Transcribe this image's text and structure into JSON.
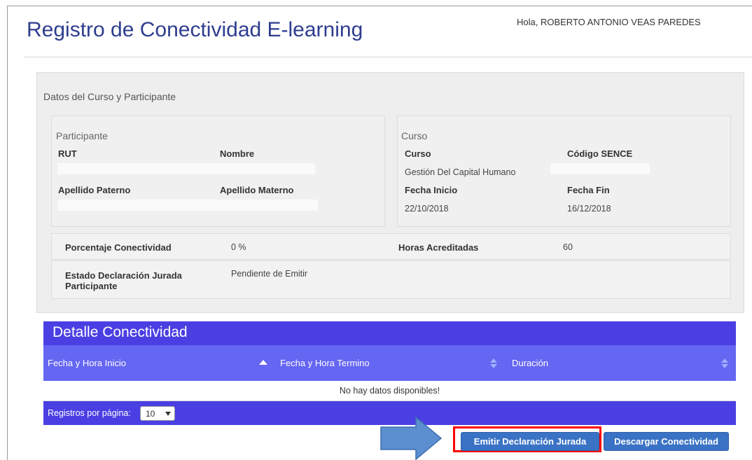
{
  "header": {
    "title": "Registro de Conectividad E-learning",
    "greeting": "Hola, ROBERTO ANTONIO VEAS PAREDES"
  },
  "datos": {
    "heading": "Datos del Curso y Participante",
    "participante": {
      "title": "Participante",
      "rut_label": "RUT",
      "nombre_label": "Nombre",
      "apellido_paterno_label": "Apellido Paterno",
      "apellido_materno_label": "Apellido Materno"
    },
    "curso": {
      "title": "Curso",
      "curso_label": "Curso",
      "curso_value": "Gestión Del Capital Humano",
      "codigo_label": "Código SENCE",
      "fecha_inicio_label": "Fecha Inicio",
      "fecha_inicio_value": "22/10/2018",
      "fecha_fin_label": "Fecha Fin",
      "fecha_fin_value": "16/12/2018"
    },
    "porcentaje_label": "Porcentaje Conectividad",
    "porcentaje_value": "0 %",
    "horas_label": "Horas Acreditadas",
    "horas_value": "60",
    "estado_label": "Estado Declaración Jurada Participante",
    "estado_value": "Pendiente de Emitir"
  },
  "detalle": {
    "title": "Detalle Conectividad",
    "columns": [
      "Fecha y Hora Inicio",
      "Fecha y Hora Termino",
      "Duración"
    ],
    "empty_message": "No hay datos disponibles!",
    "per_page_label": "Registros por página:",
    "per_page_value": "10"
  },
  "actions": {
    "emitir_label": "Emitir Declaración Jurada",
    "descargar_label": "Descargar Conectividad"
  },
  "colors": {
    "title": "#2e3d8f",
    "header_bar": "#4a3fe3",
    "table_header": "#6566f2",
    "button": "#3a73c5",
    "highlight": "#ff0000",
    "arrow": "#5b8fd0"
  }
}
